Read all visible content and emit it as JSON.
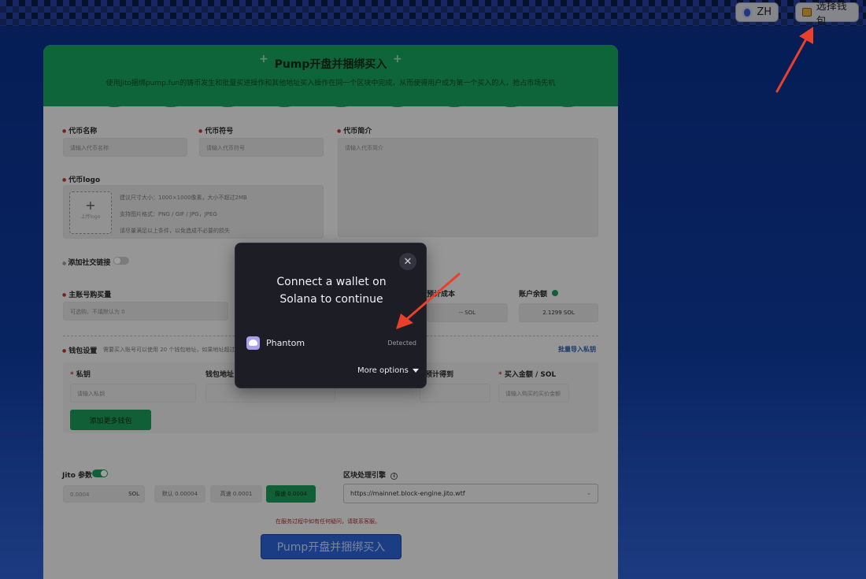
{
  "topbar": {
    "language": "ZH",
    "wallet_button": "选择钱包"
  },
  "hero": {
    "title": "Pump开盘并捆绑买入",
    "subtitle": "使用Jito捆绑pump.fun的铸币发生和批量买进操作和其他地址买入操作在同一个区块中完成，从而使得用户成为第一个买入的人，抢占市场先机"
  },
  "form": {
    "token_name_label": "代币名称",
    "token_name_placeholder": "请输入代币名称",
    "token_symbol_label": "代币符号",
    "token_symbol_placeholder": "请输入代币符号",
    "token_desc_label": "代币简介",
    "token_desc_placeholder": "请输入代币简介",
    "logo_label": "代币logo",
    "logo_upload_text": "上传logo",
    "logo_hint_1": "建议尺寸大小：1000×1000像素，大小不超过2MB",
    "logo_hint_2": "支持图片格式：PNG / GIF / JPG，JPEG",
    "logo_hint_3": "请尽量满足以上条件，以免造成不必要的损失",
    "social_label": "添加社交链接",
    "main_buy_label": "主账号购买量",
    "main_buy_placeholder": "可选购，不填默认为 0",
    "cost_label": "预计成本",
    "cost_value": "-- SOL",
    "balance_label": "账户余额",
    "balance_value": "2.1299 SOL",
    "wallet_settings_label": "钱包设置",
    "wallet_settings_hint": "需要买入账号可以使用 20 个钱包地址，如果地址超过 20 个",
    "batch_import": "批量导入私钥",
    "col_private_key": "私钥",
    "col_wallet_address": "钱包地址",
    "col_estimated": "预计得到",
    "col_buy_amount": "买入金额 / SOL",
    "private_key_placeholder": "请输入私钥",
    "buy_amount_placeholder": "请输入购买的买价金额",
    "add_wallet_button": "添加更多钱包",
    "jito_label": "Jito 参数",
    "jito_input_placeholder": "0.0004",
    "jito_unit": "SOL",
    "jito_default": "默认 0.00004",
    "jito_fast": "高速 0.0001",
    "jito_ultra": "极速 0.0004",
    "engine_label": "区块处理引擎",
    "engine_value": "https://mainnet.block-engine.jito.wtf",
    "error_note": "在服务过程中如有任何疑问，请联系客服。",
    "submit_button": "Pump开盘并捆绑买入"
  },
  "modal": {
    "title_line_1": "Connect a wallet on",
    "title_line_2": "Solana to continue",
    "close_icon": "close-icon",
    "wallet_name": "Phantom",
    "wallet_status": "Detected",
    "more_options": "More options"
  },
  "colors": {
    "accent_green": "#1a9a5a",
    "arrow_red": "#e8402a",
    "primary_blue": "#2a63d6",
    "modal_bg": "#1d1d26"
  }
}
